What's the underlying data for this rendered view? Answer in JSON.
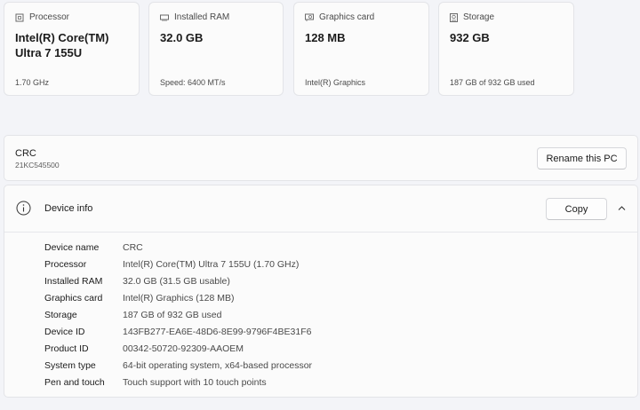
{
  "cards": [
    {
      "title": "Processor",
      "icon": "processor-icon",
      "value": "Intel(R) Core(TM) Ultra 7 155U",
      "sub": "1.70 GHz"
    },
    {
      "title": "Installed RAM",
      "icon": "ram-icon",
      "value": "32.0 GB",
      "sub": "Speed: 6400 MT/s"
    },
    {
      "title": "Graphics card",
      "icon": "graphics-card-icon",
      "value": "128 MB",
      "sub": "Intel(R) Graphics"
    },
    {
      "title": "Storage",
      "icon": "storage-icon",
      "value": "932 GB",
      "sub": "187 GB of 932 GB used"
    }
  ],
  "pc": {
    "name": "CRC",
    "model": "21KC545500",
    "rename_label": "Rename this PC"
  },
  "device_info": {
    "title": "Device info",
    "copy_label": "Copy",
    "specs": [
      {
        "label": "Device name",
        "value": "CRC"
      },
      {
        "label": "Processor",
        "value": "Intel(R) Core(TM) Ultra 7 155U (1.70 GHz)"
      },
      {
        "label": "Installed RAM",
        "value": "32.0 GB (31.5 GB usable)"
      },
      {
        "label": "Graphics card",
        "value": "Intel(R) Graphics (128 MB)"
      },
      {
        "label": "Storage",
        "value": "187 GB of 932 GB used"
      },
      {
        "label": "Device ID",
        "value": "143FB277-EA6E-48D6-8E99-9796F4BE31F6"
      },
      {
        "label": "Product ID",
        "value": "00342-50720-92309-AAOEM"
      },
      {
        "label": "System type",
        "value": "64-bit operating system, x64-based processor"
      },
      {
        "label": "Pen and touch",
        "value": "Touch support with 10 touch points"
      }
    ]
  }
}
